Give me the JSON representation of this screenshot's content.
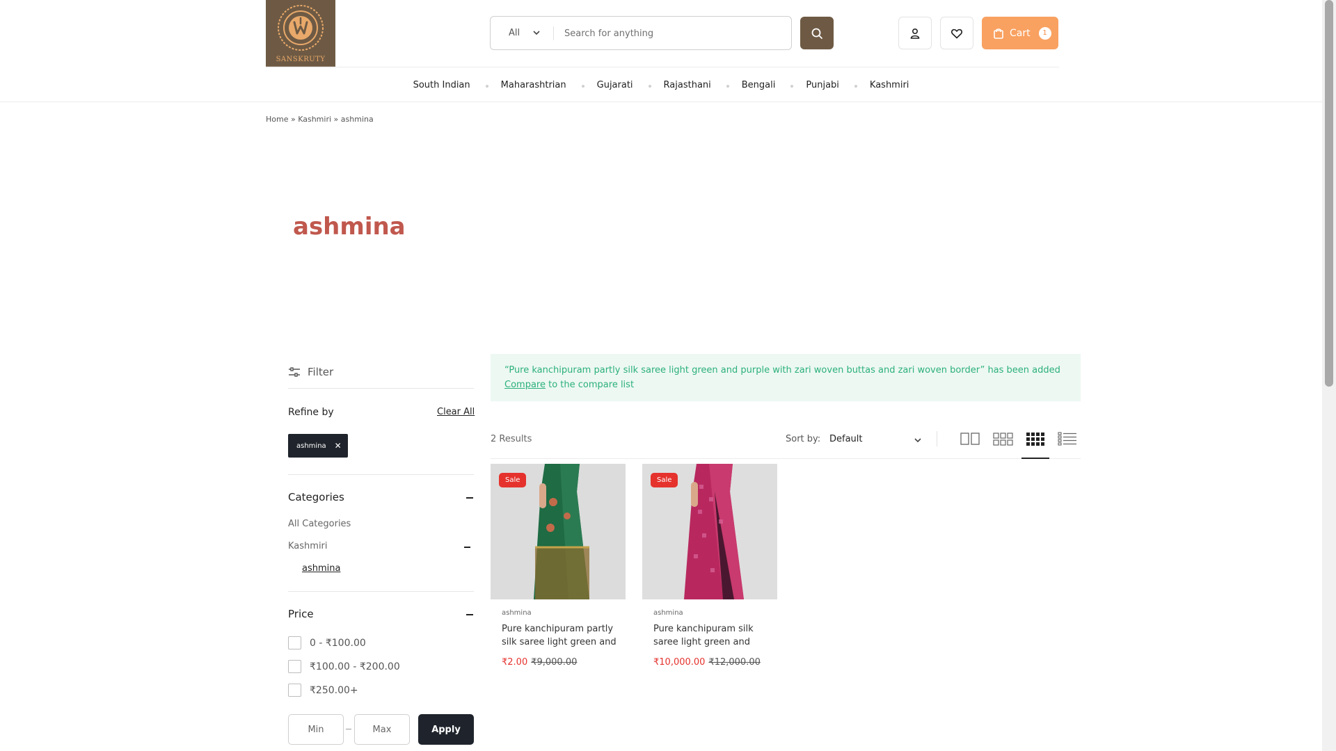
{
  "brand": {
    "name": "SANSKRUTY"
  },
  "search": {
    "category": "All",
    "placeholder": "Search for anything"
  },
  "header": {
    "cart_label": "Cart",
    "cart_count": "1"
  },
  "nav": {
    "items": [
      "South Indian",
      "Maharashtrian",
      "Gujarati",
      "Rajasthani",
      "Bengali",
      "Punjabi",
      "Kashmiri"
    ]
  },
  "breadcrumb": {
    "home": "Home",
    "sep1": " » ",
    "category": "Kashmiri",
    "sep2": " » ",
    "current": "ashmina"
  },
  "page": {
    "title": "ashmina"
  },
  "sidebar": {
    "filter_label": "Filter",
    "refine_by": "Refine by",
    "clear_all": "Clear All",
    "active_filter": "ashmina",
    "categories_heading": "Categories",
    "categories": {
      "all": "All Categories",
      "parent": "Kashmiri",
      "child": "ashmina"
    },
    "price_heading": "Price",
    "price_ranges": [
      "0 - ₹100.00",
      "₹100.00 - ₹200.00",
      "₹250.00+"
    ],
    "min_placeholder": "Min",
    "max_placeholder": "Max",
    "apply_label": "Apply"
  },
  "notice": {
    "message": "“Pure kanchipuram partly silk saree light green and purple with zari woven buttas and zari woven border” has been added",
    "link": "Compare",
    "suffix": "to the compare list"
  },
  "toolbar": {
    "results": "2 Results",
    "sort_label": "Sort by:",
    "sort_value": "Default"
  },
  "products": [
    {
      "badge": "Sale",
      "category": "ashmina",
      "title": "Pure kanchipuram partly silk saree light green and",
      "price": "₹2.00",
      "old_price": "₹9,000.00"
    },
    {
      "badge": "Sale",
      "category": "ashmina",
      "title": "Pure kanchipuram silk saree light green and",
      "price": "₹10,000.00",
      "old_price": "₹12,000.00"
    }
  ],
  "colors": {
    "brand": "#6e5a44",
    "cart": "#f9a161",
    "title": "#c0584d",
    "sale": "#e5322d",
    "notice_bg": "#edf8f3",
    "notice_text": "#2bb07a",
    "dark": "#1f242c"
  }
}
